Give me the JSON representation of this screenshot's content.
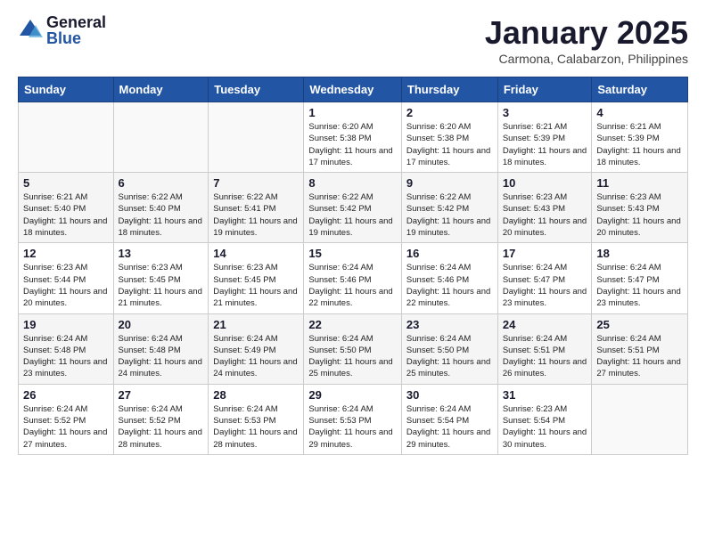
{
  "logo": {
    "general": "General",
    "blue": "Blue"
  },
  "title": {
    "month": "January 2025",
    "location": "Carmona, Calabarzon, Philippines"
  },
  "weekdays": [
    "Sunday",
    "Monday",
    "Tuesday",
    "Wednesday",
    "Thursday",
    "Friday",
    "Saturday"
  ],
  "weeks": [
    [
      {
        "day": "",
        "info": ""
      },
      {
        "day": "",
        "info": ""
      },
      {
        "day": "",
        "info": ""
      },
      {
        "day": "1",
        "info": "Sunrise: 6:20 AM\nSunset: 5:38 PM\nDaylight: 11 hours and 17 minutes."
      },
      {
        "day": "2",
        "info": "Sunrise: 6:20 AM\nSunset: 5:38 PM\nDaylight: 11 hours and 17 minutes."
      },
      {
        "day": "3",
        "info": "Sunrise: 6:21 AM\nSunset: 5:39 PM\nDaylight: 11 hours and 18 minutes."
      },
      {
        "day": "4",
        "info": "Sunrise: 6:21 AM\nSunset: 5:39 PM\nDaylight: 11 hours and 18 minutes."
      }
    ],
    [
      {
        "day": "5",
        "info": "Sunrise: 6:21 AM\nSunset: 5:40 PM\nDaylight: 11 hours and 18 minutes."
      },
      {
        "day": "6",
        "info": "Sunrise: 6:22 AM\nSunset: 5:40 PM\nDaylight: 11 hours and 18 minutes."
      },
      {
        "day": "7",
        "info": "Sunrise: 6:22 AM\nSunset: 5:41 PM\nDaylight: 11 hours and 19 minutes."
      },
      {
        "day": "8",
        "info": "Sunrise: 6:22 AM\nSunset: 5:42 PM\nDaylight: 11 hours and 19 minutes."
      },
      {
        "day": "9",
        "info": "Sunrise: 6:22 AM\nSunset: 5:42 PM\nDaylight: 11 hours and 19 minutes."
      },
      {
        "day": "10",
        "info": "Sunrise: 6:23 AM\nSunset: 5:43 PM\nDaylight: 11 hours and 20 minutes."
      },
      {
        "day": "11",
        "info": "Sunrise: 6:23 AM\nSunset: 5:43 PM\nDaylight: 11 hours and 20 minutes."
      }
    ],
    [
      {
        "day": "12",
        "info": "Sunrise: 6:23 AM\nSunset: 5:44 PM\nDaylight: 11 hours and 20 minutes."
      },
      {
        "day": "13",
        "info": "Sunrise: 6:23 AM\nSunset: 5:45 PM\nDaylight: 11 hours and 21 minutes."
      },
      {
        "day": "14",
        "info": "Sunrise: 6:23 AM\nSunset: 5:45 PM\nDaylight: 11 hours and 21 minutes."
      },
      {
        "day": "15",
        "info": "Sunrise: 6:24 AM\nSunset: 5:46 PM\nDaylight: 11 hours and 22 minutes."
      },
      {
        "day": "16",
        "info": "Sunrise: 6:24 AM\nSunset: 5:46 PM\nDaylight: 11 hours and 22 minutes."
      },
      {
        "day": "17",
        "info": "Sunrise: 6:24 AM\nSunset: 5:47 PM\nDaylight: 11 hours and 23 minutes."
      },
      {
        "day": "18",
        "info": "Sunrise: 6:24 AM\nSunset: 5:47 PM\nDaylight: 11 hours and 23 minutes."
      }
    ],
    [
      {
        "day": "19",
        "info": "Sunrise: 6:24 AM\nSunset: 5:48 PM\nDaylight: 11 hours and 23 minutes."
      },
      {
        "day": "20",
        "info": "Sunrise: 6:24 AM\nSunset: 5:48 PM\nDaylight: 11 hours and 24 minutes."
      },
      {
        "day": "21",
        "info": "Sunrise: 6:24 AM\nSunset: 5:49 PM\nDaylight: 11 hours and 24 minutes."
      },
      {
        "day": "22",
        "info": "Sunrise: 6:24 AM\nSunset: 5:50 PM\nDaylight: 11 hours and 25 minutes."
      },
      {
        "day": "23",
        "info": "Sunrise: 6:24 AM\nSunset: 5:50 PM\nDaylight: 11 hours and 25 minutes."
      },
      {
        "day": "24",
        "info": "Sunrise: 6:24 AM\nSunset: 5:51 PM\nDaylight: 11 hours and 26 minutes."
      },
      {
        "day": "25",
        "info": "Sunrise: 6:24 AM\nSunset: 5:51 PM\nDaylight: 11 hours and 27 minutes."
      }
    ],
    [
      {
        "day": "26",
        "info": "Sunrise: 6:24 AM\nSunset: 5:52 PM\nDaylight: 11 hours and 27 minutes."
      },
      {
        "day": "27",
        "info": "Sunrise: 6:24 AM\nSunset: 5:52 PM\nDaylight: 11 hours and 28 minutes."
      },
      {
        "day": "28",
        "info": "Sunrise: 6:24 AM\nSunset: 5:53 PM\nDaylight: 11 hours and 28 minutes."
      },
      {
        "day": "29",
        "info": "Sunrise: 6:24 AM\nSunset: 5:53 PM\nDaylight: 11 hours and 29 minutes."
      },
      {
        "day": "30",
        "info": "Sunrise: 6:24 AM\nSunset: 5:54 PM\nDaylight: 11 hours and 29 minutes."
      },
      {
        "day": "31",
        "info": "Sunrise: 6:23 AM\nSunset: 5:54 PM\nDaylight: 11 hours and 30 minutes."
      },
      {
        "day": "",
        "info": ""
      }
    ]
  ]
}
